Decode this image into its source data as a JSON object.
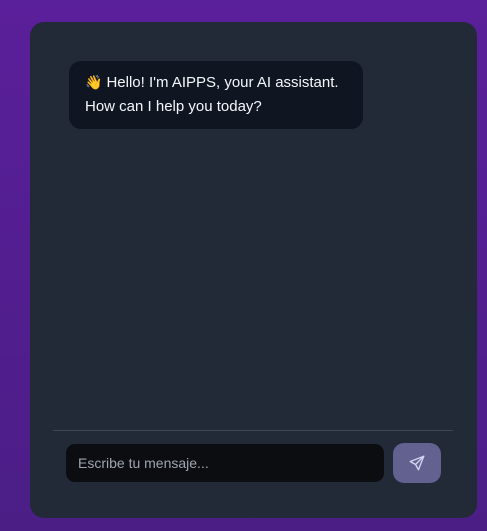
{
  "chat": {
    "greeting_emoji": "👋",
    "greeting_text": "Hello! I'm AIPPS, your AI assistant. How can I help you today?",
    "input_placeholder": "Escribe tu mensaje...",
    "send_icon": "paper-plane-send-icon"
  },
  "colors": {
    "background": "#5a1f9a",
    "panel": "#222a38",
    "bubble": "#0f1622",
    "input": "#0b0d10",
    "send_button": "#626190"
  }
}
